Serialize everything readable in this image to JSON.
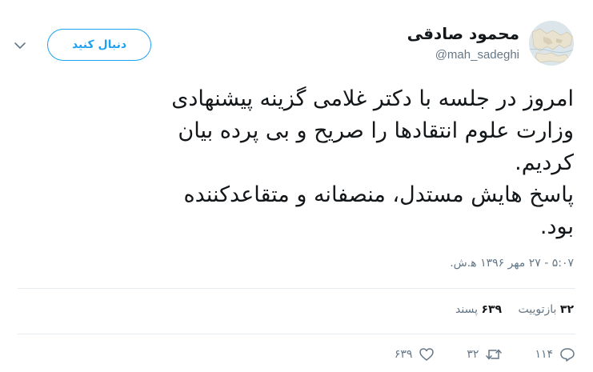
{
  "author": {
    "name": "محمود صادقی",
    "handle": "@mah_sadeghi"
  },
  "follow_button": {
    "label": "دنبال کنید"
  },
  "tweet": {
    "lines": [
      "امروز در جلسه با دکتر غلامی گزینه پیشنهادی",
      "وزارت علوم انتقادها را صریح و بی پرده بیان",
      "کردیم.",
      "پاسخ هایش مستدل، منصفانه و متقاعدکننده",
      "بود."
    ],
    "timestamp": "۵:۰۷ - ۲۷ مهر ۱۳۹۶ ه‍.ش."
  },
  "stats": {
    "retweets_count": "۳۲",
    "retweets_label": "بازتوییت",
    "likes_count": "۶۳۹",
    "likes_label": "پسند"
  },
  "actions": {
    "reply_count": "۱۱۴",
    "retweet_count": "۳۲",
    "like_count": "۶۳۹"
  },
  "icons": {
    "caret": "chevron-down-icon",
    "reply": "reply-icon",
    "retweet": "retweet-icon",
    "like": "heart-icon"
  },
  "colors": {
    "accent": "#1da1f2",
    "muted": "#657786",
    "text": "#14171a",
    "divider": "#e6ecf0"
  }
}
